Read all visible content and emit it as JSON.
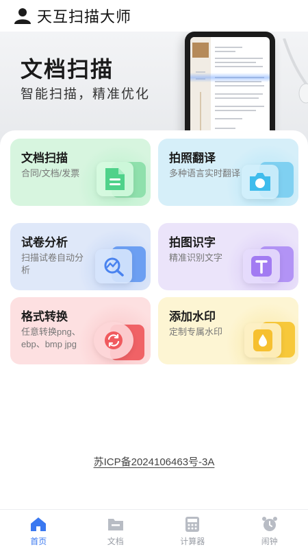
{
  "header": {
    "title": "天互扫描大师",
    "user_icon": "user-icon"
  },
  "banner": {
    "title": "文档扫描",
    "subtitle": "智能扫描，精准优化"
  },
  "cards": [
    {
      "title": "文档扫描",
      "desc": "合同/文档/发票",
      "icon": "document-icon",
      "color": "#d7f5df",
      "accent": "#38c77a"
    },
    {
      "title": "拍照翻译",
      "desc": "多种语言实时翻译",
      "icon": "camera-icon",
      "color": "#d6eff9",
      "accent": "#2fb3e8"
    },
    {
      "title": "试卷分析",
      "desc": "扫描试卷自动分析",
      "icon": "analysis-icon",
      "color": "#dfe8f9",
      "accent": "#4a83ef"
    },
    {
      "title": "拍图识字",
      "desc": "精准识别文字",
      "icon": "text-recognition-icon",
      "color": "#ebe4fa",
      "accent": "#9a6df0"
    },
    {
      "title": "格式转换",
      "desc": "任意转换png、ebp、bmp jpg",
      "icon": "convert-icon",
      "color": "#fde0e1",
      "accent": "#f05a5e"
    },
    {
      "title": "添加水印",
      "desc": "定制专属水印",
      "icon": "watermark-icon",
      "color": "#fdf5d3",
      "accent": "#f6c030"
    }
  ],
  "footer": {
    "icp": "苏ICP备2024106463号-3A"
  },
  "nav": [
    {
      "label": "首页",
      "icon": "home-icon",
      "active": true
    },
    {
      "label": "文档",
      "icon": "folder-icon",
      "active": false
    },
    {
      "label": "计算器",
      "icon": "calculator-icon",
      "active": false
    },
    {
      "label": "闹钟",
      "icon": "alarm-clock-icon",
      "active": false
    }
  ]
}
